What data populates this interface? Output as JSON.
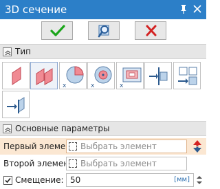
{
  "window": {
    "title": "3D сечение",
    "pin_icon": "pin-icon",
    "close_icon": "close-icon"
  },
  "actions": {
    "ok_icon": "checkmark-icon",
    "view_icon": "magnifier-icon",
    "cancel_icon": "cross-icon"
  },
  "sections": {
    "type_label": "Тип",
    "params_label": "Основные параметры"
  },
  "section_types": [
    {
      "icon": "plane-section-icon",
      "selected": false
    },
    {
      "icon": "two-planes-section-icon",
      "selected": true
    },
    {
      "icon": "cylinder-cut-icon",
      "selected": false
    },
    {
      "icon": "sphere-cut-icon",
      "selected": false
    },
    {
      "icon": "box-cut-icon",
      "selected": false
    },
    {
      "icon": "plane-arrow-icon",
      "selected": false
    },
    {
      "icon": "grid-arrow-icon",
      "selected": false
    },
    {
      "icon": "arrow-plane-icon",
      "selected": false
    }
  ],
  "params": {
    "first_element_label": "Первый элемент:",
    "first_element_placeholder": "Выбрать элемент",
    "second_element_label": "Второй элемент:",
    "second_element_placeholder": "Выбрать элемент",
    "offset_label": "Смещение:",
    "offset_checked": true,
    "offset_value": "50",
    "offset_unit": "[мм]"
  },
  "colors": {
    "accent": "#2c7fc8",
    "ok": "#1aa51a",
    "cancel": "#d32222",
    "highlight_row": "#fbe7d2"
  }
}
